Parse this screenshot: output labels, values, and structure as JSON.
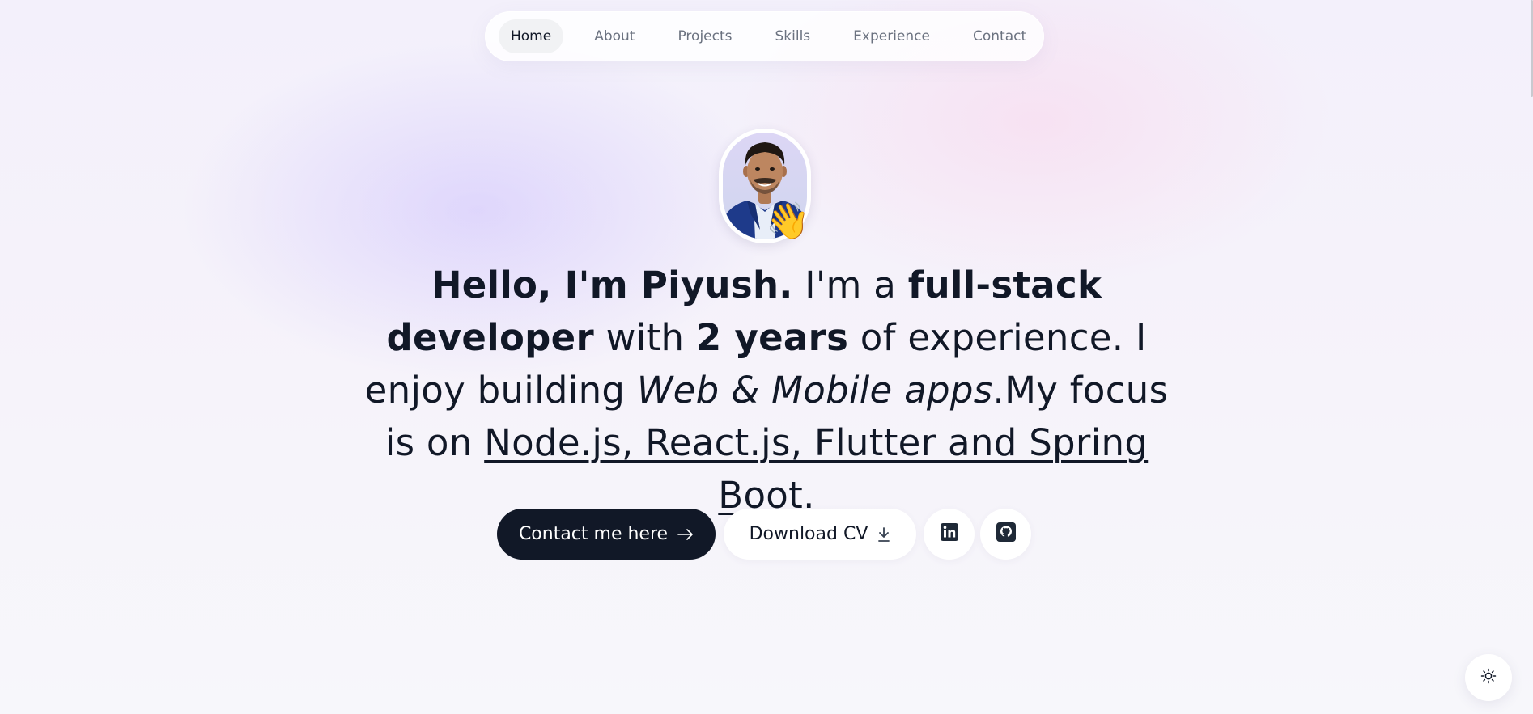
{
  "nav": {
    "items": [
      {
        "label": "Home",
        "active": true
      },
      {
        "label": "About",
        "active": false
      },
      {
        "label": "Projects",
        "active": false
      },
      {
        "label": "Skills",
        "active": false
      },
      {
        "label": "Experience",
        "active": false
      },
      {
        "label": "Contact",
        "active": false
      }
    ]
  },
  "profile": {
    "wave_emoji": "👋"
  },
  "hero": {
    "greeting": "Hello, I'm Piyush.",
    "im_a": " I'm a ",
    "role": "full-stack developer",
    "with": " with ",
    "years": "2 years",
    "experience_text": " of experience. I enjoy building ",
    "apps": "Web & Mobile apps",
    "focus_text": ".My focus is on ",
    "tech": "Node.js, React.js, Flutter and Spring Boot",
    "end": "."
  },
  "actions": {
    "contact_label": "Contact me here",
    "contact_icon": "arrow-right-icon",
    "cv_label": "Download CV",
    "cv_icon": "download-icon",
    "linkedin_icon": "linkedin-icon",
    "github_icon": "github-icon"
  },
  "theme_toggle": {
    "icon": "sun-icon"
  },
  "colors": {
    "primary_dark": "#111827",
    "nav_text": "#6b7280",
    "active_pill": "#f1f2f4",
    "background": "#f3f0fb"
  }
}
